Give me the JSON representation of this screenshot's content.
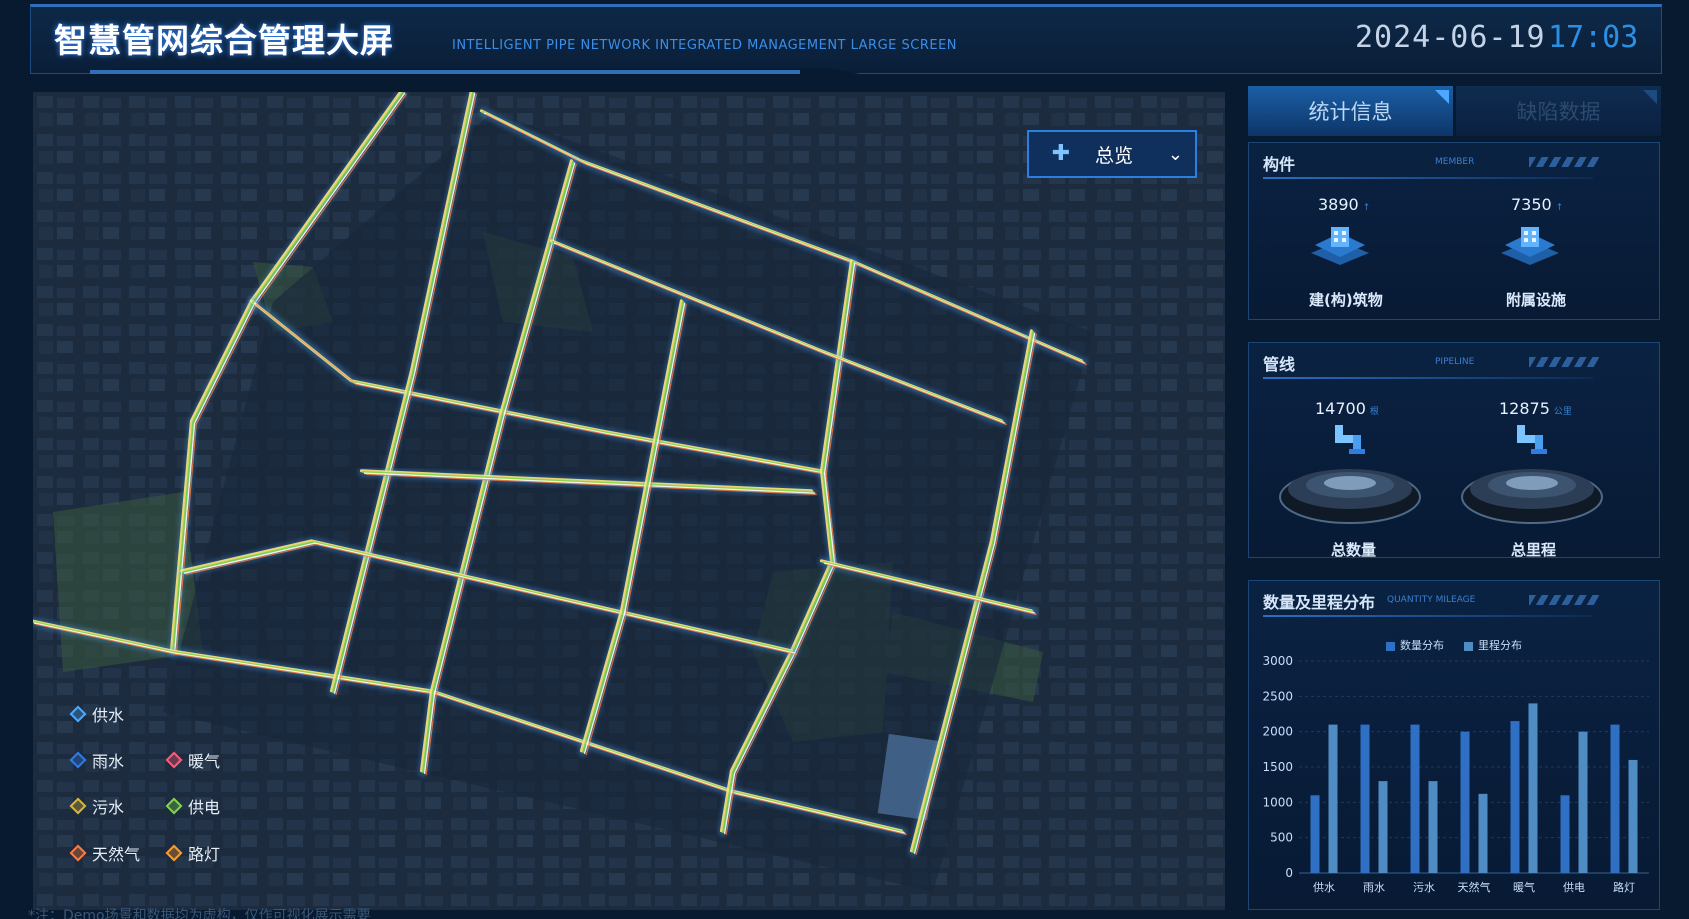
{
  "header": {
    "title": "智慧管网综合管理大屏",
    "subtitle": "INTELLIGENT PIPE NETWORK INTEGRATED MANAGEMENT LARGE SCREEN",
    "date": "2024-06-19",
    "time": "17:03"
  },
  "map": {
    "overview_label": "总览",
    "overview_icon": "pipe-network-icon",
    "legend": [
      {
        "label": "供水",
        "color": "#4aa8ff"
      },
      {
        "label": "雨水",
        "color": "#2f7be8"
      },
      {
        "label": "暖气",
        "color": "#ff5a7a"
      },
      {
        "label": "污水",
        "color": "#d8b43a"
      },
      {
        "label": "供电",
        "color": "#7ed64a"
      },
      {
        "label": "天然气",
        "color": "#ff7a3a"
      },
      {
        "label": "路灯",
        "color": "#ff9a2a"
      }
    ],
    "note": "*注：Demo场景和数据均为虚构，仅作可视化展示需要"
  },
  "tabs": [
    {
      "label": "统计信息",
      "active": true
    },
    {
      "label": "缺陷数据",
      "active": false
    }
  ],
  "components": {
    "title": "构件",
    "title_en": "MEMBER",
    "items": [
      {
        "value": "3890",
        "label": "建(构)筑物"
      },
      {
        "value": "7350",
        "label": "附属设施"
      }
    ]
  },
  "pipelines": {
    "title": "管线",
    "title_en": "PIPELINE",
    "items": [
      {
        "value": "14700",
        "unit": "根",
        "label": "总数量"
      },
      {
        "value": "12875",
        "unit": "公里",
        "label": "总里程"
      }
    ]
  },
  "distribution": {
    "title": "数量及里程分布",
    "title_en": "QUANTITY MILEAGE",
    "legend": [
      "数量分布",
      "里程分布"
    ],
    "colors": {
      "quantity": "#2f6fc4",
      "mileage": "#4f8cc4"
    }
  },
  "chart_data": {
    "type": "bar",
    "categories": [
      "供水",
      "雨水",
      "污水",
      "天然气",
      "暖气",
      "供电",
      "路灯"
    ],
    "series": [
      {
        "name": "数量分布",
        "values": [
          1100,
          2100,
          2100,
          2000,
          2150,
          1100,
          2100
        ]
      },
      {
        "name": "里程分布",
        "values": [
          2100,
          1300,
          1300,
          1120,
          2400,
          2000,
          1600
        ]
      }
    ],
    "ylim": [
      0,
      3000
    ],
    "yticks": [
      0,
      500,
      1000,
      1500,
      2000,
      2500,
      3000
    ],
    "legend_position": "top-center",
    "grid": true
  }
}
